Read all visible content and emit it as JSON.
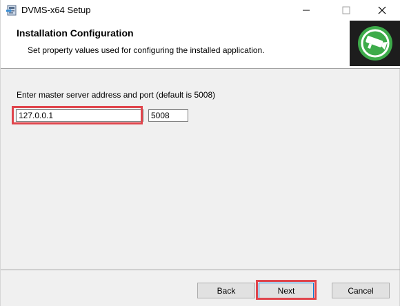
{
  "window": {
    "title": "DVMS-x64 Setup",
    "controls": {
      "minimize": "minimize-icon",
      "maximize": "maximize-icon",
      "close": "close-icon"
    }
  },
  "banner": {
    "title": "Installation Configuration",
    "subtitle": "Set property values used for configuring the installed application.",
    "logo_icon": "security-camera-icon",
    "logo_bg": "#1d1d1d",
    "logo_circle": "#3dab4a"
  },
  "form": {
    "prompt": "Enter master server address and port (default is 5008)",
    "address_value": "127.0.0.1",
    "port_value": "5008"
  },
  "buttons": {
    "back": "Back",
    "next": "Next",
    "cancel": "Cancel"
  },
  "colors": {
    "highlight": "#e0454c",
    "button_face": "#e1e1e1",
    "focus_border": "#0078d7"
  }
}
